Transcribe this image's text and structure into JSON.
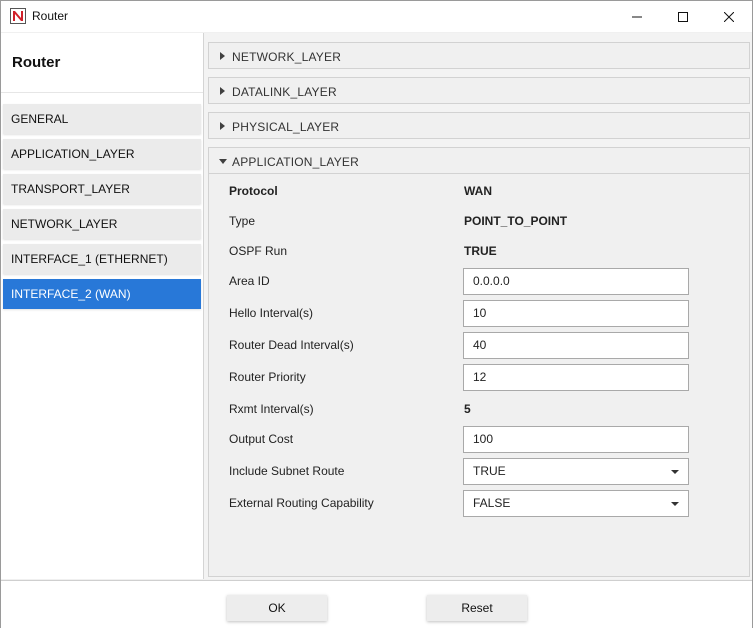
{
  "window": {
    "title": "Router"
  },
  "sidebar": {
    "title": "Router",
    "items": [
      {
        "label": "GENERAL"
      },
      {
        "label": "APPLICATION_LAYER"
      },
      {
        "label": "TRANSPORT_LAYER"
      },
      {
        "label": "NETWORK_LAYER"
      },
      {
        "label": "INTERFACE_1 (ETHERNET)"
      },
      {
        "label": "INTERFACE_2 (WAN)",
        "active": true
      }
    ]
  },
  "accordion": {
    "sections": [
      {
        "label": "NETWORK_LAYER",
        "expanded": false
      },
      {
        "label": "DATALINK_LAYER",
        "expanded": false
      },
      {
        "label": "PHYSICAL_LAYER",
        "expanded": false
      },
      {
        "label": "APPLICATION_LAYER",
        "expanded": true
      }
    ]
  },
  "properties": {
    "protocol": {
      "label": "Protocol",
      "value": "WAN"
    },
    "type": {
      "label": "Type",
      "value": "POINT_TO_POINT"
    },
    "ospf_run": {
      "label": "OSPF Run",
      "value": "TRUE"
    },
    "area_id": {
      "label": "Area ID",
      "value": "0.0.0.0"
    },
    "hello_interval": {
      "label": "Hello Interval(s)",
      "value": "10"
    },
    "router_dead_interval": {
      "label": "Router Dead Interval(s)",
      "value": "40"
    },
    "router_priority": {
      "label": "Router Priority",
      "value": "12"
    },
    "rxmt_interval": {
      "label": "Rxmt Interval(s)",
      "value": "5"
    },
    "output_cost": {
      "label": "Output Cost",
      "value": "100"
    },
    "include_subnet_route": {
      "label": "Include Subnet Route",
      "value": "TRUE"
    },
    "external_routing_capability": {
      "label": "External Routing Capability",
      "value": "FALSE"
    }
  },
  "footer": {
    "ok_label": "OK",
    "reset_label": "Reset"
  },
  "colors": {
    "accent": "#2878d8",
    "logo_red": "#d0202a"
  }
}
